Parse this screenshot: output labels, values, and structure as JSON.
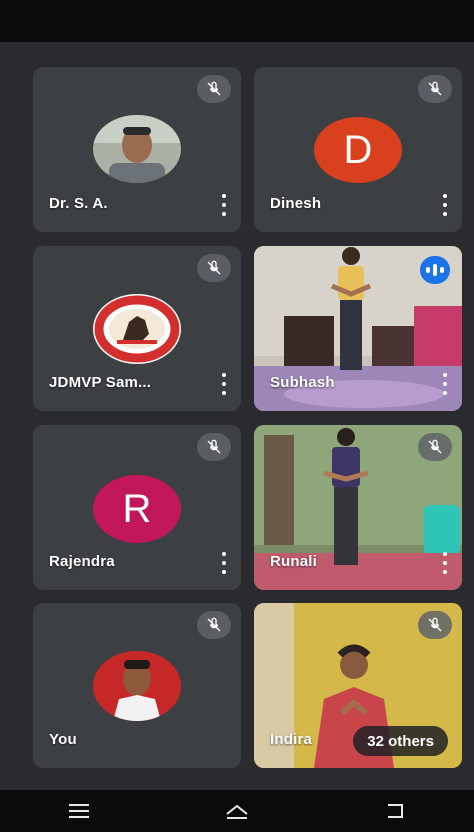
{
  "participants": [
    {
      "name": "Dr. S. A.",
      "type": "photo-avatar",
      "muted": true
    },
    {
      "name": "Dinesh",
      "type": "initial",
      "initial": "D",
      "color": "#d9411e",
      "muted": true
    },
    {
      "name": "JDMVP Sam...",
      "type": "logo",
      "muted": true
    },
    {
      "name": "Subhash",
      "type": "video",
      "speaking": true
    },
    {
      "name": "Rajendra",
      "type": "initial",
      "initial": "R",
      "color": "#c2185b",
      "muted": true
    },
    {
      "name": "Runali",
      "type": "video",
      "muted": true
    },
    {
      "name": "You",
      "type": "photo-avatar",
      "muted": true
    },
    {
      "name": "Indira",
      "type": "video",
      "muted": true,
      "others_label": "32 others"
    }
  ],
  "icons": {
    "mic_off": "mic-off-icon",
    "speaking": "audio-level-icon",
    "more": "more-vert-icon",
    "nav_recents": "menu-icon",
    "nav_home": "home-icon",
    "nav_back": "back-icon"
  },
  "colors": {
    "tile_bg": "#3c4043",
    "speaking_accent": "#1a73e8",
    "page_bg": "#2a2b2e"
  }
}
